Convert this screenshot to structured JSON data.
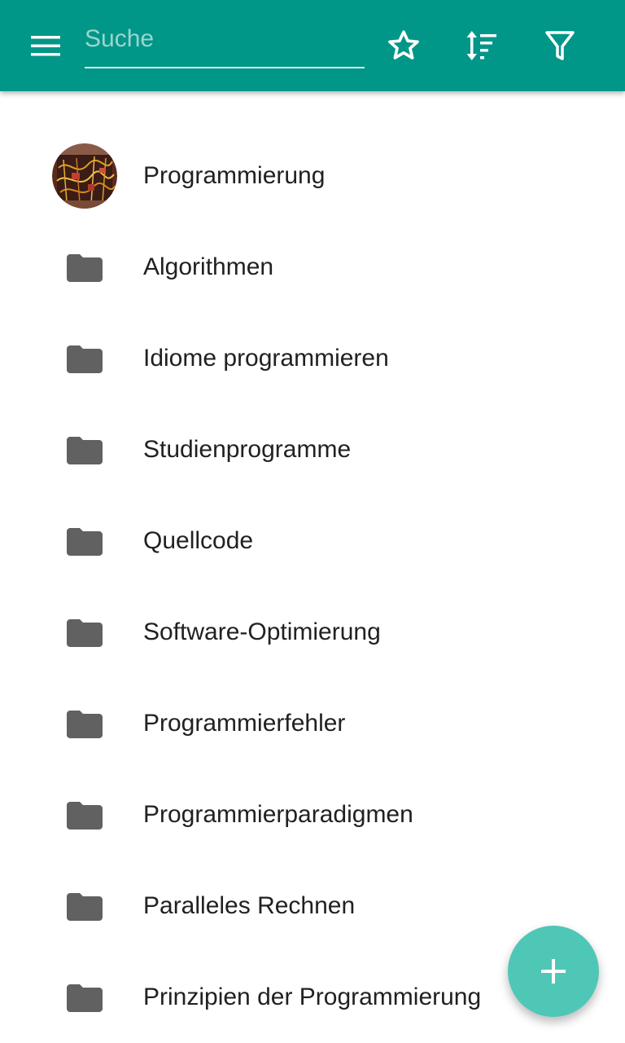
{
  "toolbar": {
    "background_color": "#009688",
    "menu_icon": "menu-icon",
    "search": {
      "placeholder": "Suche",
      "value": ""
    },
    "actions": [
      {
        "name": "favorites",
        "icon": "star-outline-icon"
      },
      {
        "name": "sort",
        "icon": "sort-icon"
      },
      {
        "name": "filter",
        "icon": "filter-icon"
      }
    ]
  },
  "category_list": {
    "items": [
      {
        "label": "Programmierung",
        "icon": "category-image-avatar"
      },
      {
        "label": "Algorithmen",
        "icon": "folder-icon"
      },
      {
        "label": "Idiome programmieren",
        "icon": "folder-icon"
      },
      {
        "label": "Studienprogramme",
        "icon": "folder-icon"
      },
      {
        "label": "Quellcode",
        "icon": "folder-icon"
      },
      {
        "label": "Software-Optimierung",
        "icon": "folder-icon"
      },
      {
        "label": "Programmierfehler",
        "icon": "folder-icon"
      },
      {
        "label": "Programmierparadigmen",
        "icon": "folder-icon"
      },
      {
        "label": "Paralleles Rechnen",
        "icon": "folder-icon"
      },
      {
        "label": "Prinzipien der Programmierung",
        "icon": "folder-icon"
      }
    ],
    "folder_icon_color": "#616161",
    "text_color": "#212121"
  },
  "fab": {
    "icon": "plus-icon",
    "background_color": "#4fc7b6"
  }
}
